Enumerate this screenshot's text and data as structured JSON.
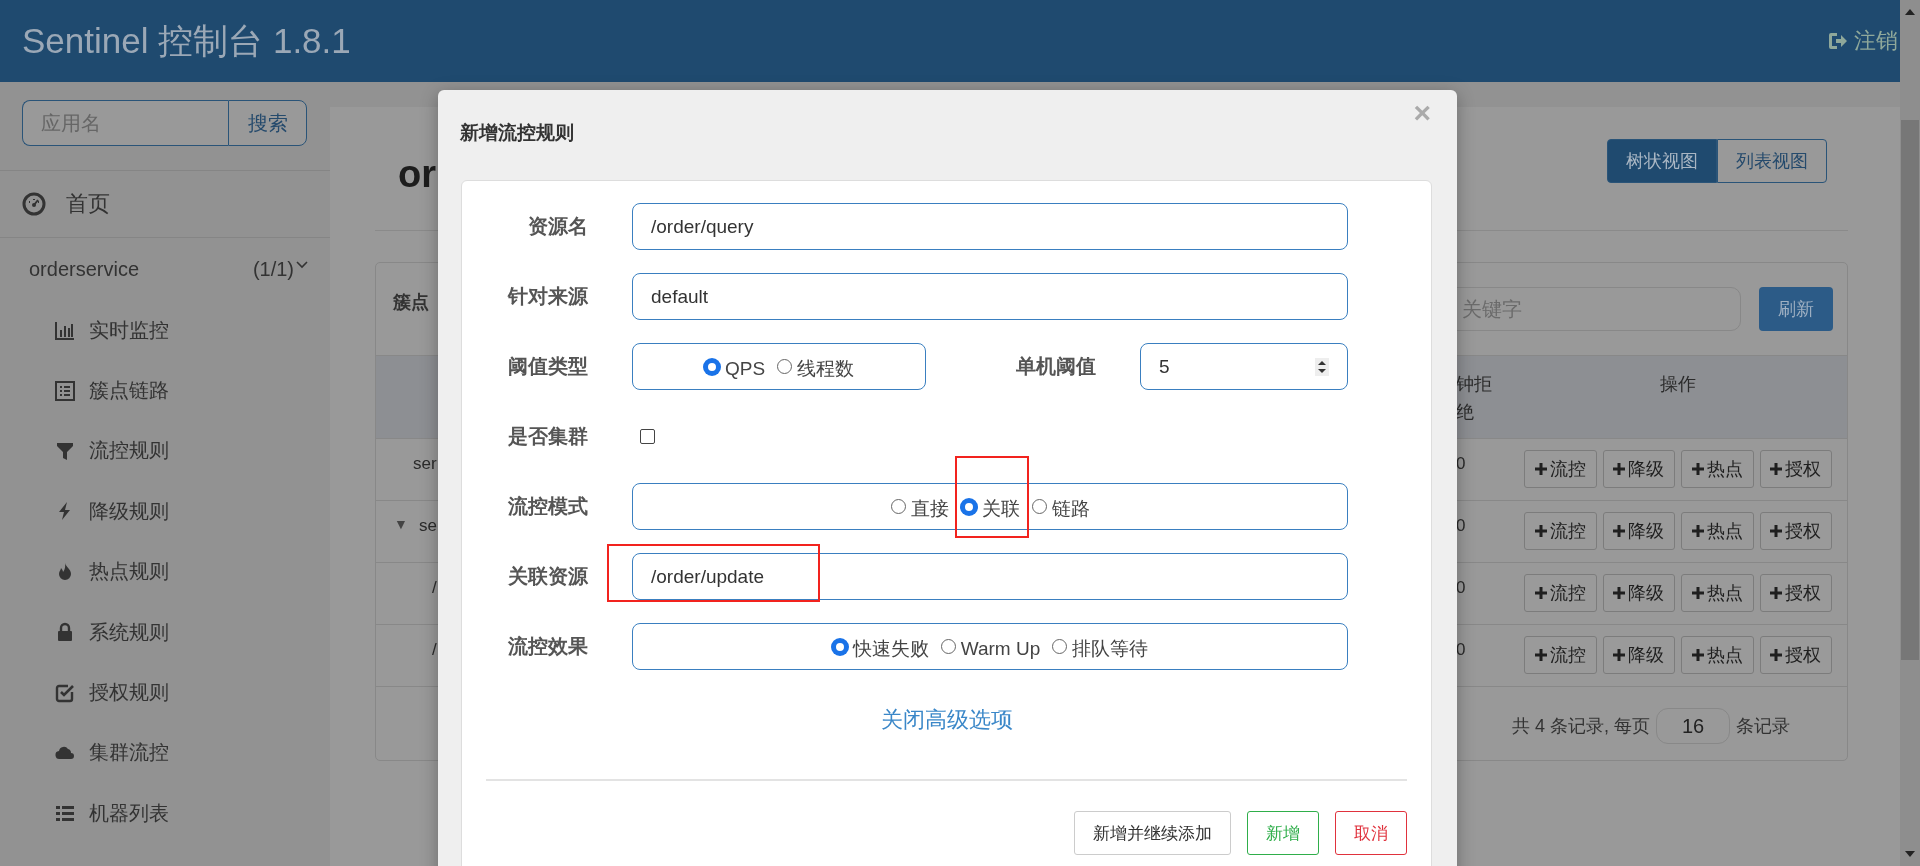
{
  "header": {
    "title": "Sentinel 控制台 1.8.1",
    "logout": "注销"
  },
  "sidebar": {
    "search": {
      "placeholder": "应用名",
      "button": "搜索"
    },
    "home": "首页",
    "app": {
      "name": "orderservice",
      "count": "(1/1)",
      "expanded": true
    },
    "menu": [
      {
        "label": "实时监控",
        "kind": "chart"
      },
      {
        "label": "簇点链路",
        "kind": "list"
      },
      {
        "label": "流控规则",
        "kind": "filter"
      },
      {
        "label": "降级规则",
        "kind": "bolt"
      },
      {
        "label": "热点规则",
        "kind": "fire"
      },
      {
        "label": "系统规则",
        "kind": "lock"
      },
      {
        "label": "授权规则",
        "kind": "check"
      },
      {
        "label": "集群流控",
        "kind": "cloud"
      },
      {
        "label": "机器列表",
        "kind": "bullets"
      }
    ]
  },
  "main": {
    "heading": "or",
    "views": [
      {
        "label": "树状视图",
        "selected": true
      },
      {
        "label": "列表视图",
        "selected": false
      }
    ],
    "table": {
      "title": "簇点",
      "search": {
        "placeholder": "关键字"
      },
      "refresh": "刷新",
      "columns": {
        "column_1": "钟拒绝",
        "column_2": "操作"
      },
      "rows": [
        {
          "name": "ser",
          "value": "0",
          "actions": [
            "流控",
            "降级",
            "热点",
            "授权"
          ]
        },
        {
          "name": "se",
          "toggle": "▼",
          "value": "0",
          "actions": [
            "流控",
            "降级",
            "热点",
            "授权"
          ],
          "children": [
            {
              "name": "/",
              "value": "0",
              "actions": [
                "流控",
                "降级",
                "热点",
                "授权"
              ]
            },
            {
              "name": "/",
              "value": "0",
              "actions": [
                "流控",
                "降级",
                "热点",
                "授权"
              ]
            }
          ]
        }
      ],
      "footer": {
        "prefix": "共 4 条记录, 每页",
        "page_size": "16",
        "suffix": "条记录"
      }
    }
  },
  "modal": {
    "title": "新增流控规则",
    "close": "×",
    "rows": [
      {
        "kind": "text",
        "label": "资源名",
        "value": "/order/query"
      },
      {
        "kind": "text",
        "label": "针对来源",
        "value": "default"
      },
      {
        "kind": "radio_number",
        "label": "阈值类型",
        "options": [
          {
            "label": "QPS",
            "selected": true
          },
          {
            "label": "线程数",
            "selected": false
          }
        ],
        "number_label": "单机阈值",
        "number_value": "5"
      },
      {
        "kind": "checkbox",
        "label": "是否集群",
        "checked": false
      },
      {
        "kind": "radio",
        "label": "流控模式",
        "options": [
          {
            "label": "直接",
            "selected": false
          },
          {
            "label": "关联",
            "selected": true,
            "highlighted": true
          },
          {
            "label": "链路",
            "selected": false
          }
        ]
      },
      {
        "kind": "text",
        "label": "关联资源",
        "value": "/order/update",
        "highlighted": true
      },
      {
        "kind": "radio",
        "label": "流控效果",
        "options": [
          {
            "label": "快速失败",
            "selected": true
          },
          {
            "label": "Warm Up",
            "selected": false
          },
          {
            "label": "排队等待",
            "selected": false
          }
        ]
      }
    ],
    "advanced_link": "关闭高级选项",
    "buttons": [
      {
        "label": "新增并继续添加",
        "kind": "default"
      },
      {
        "label": "新增",
        "kind": "success"
      },
      {
        "label": "取消",
        "kind": "danger"
      }
    ]
  }
}
